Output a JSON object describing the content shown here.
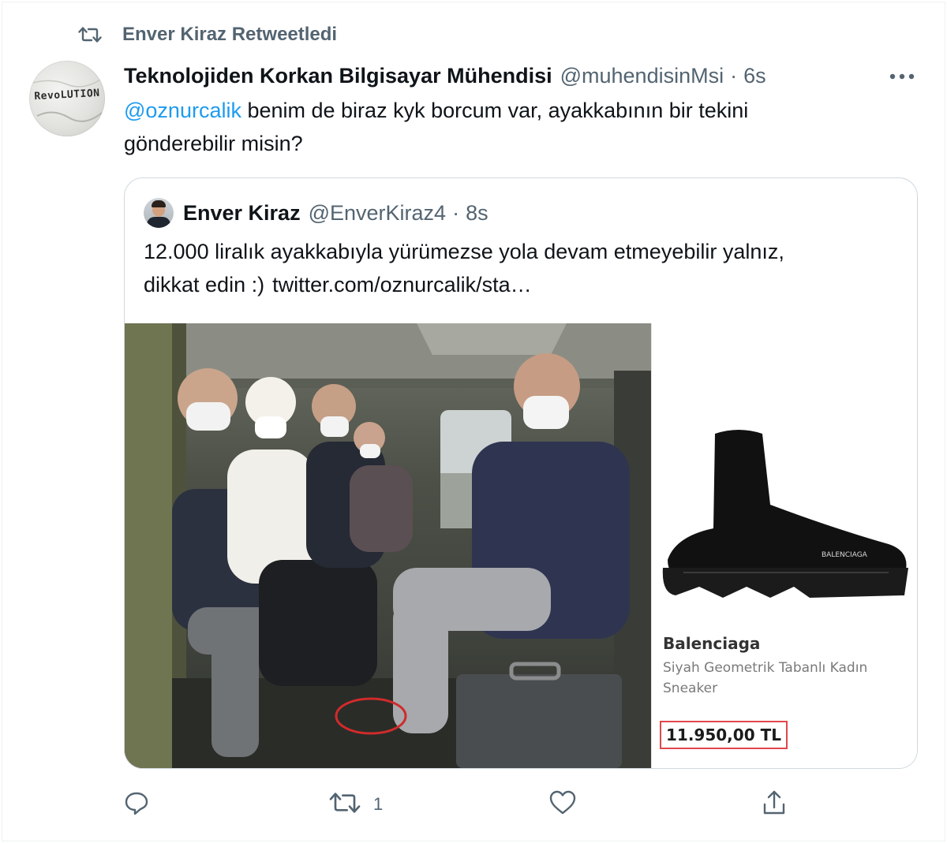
{
  "retweet_header": {
    "icon": "retweet-icon",
    "text": "Enver Kiraz Retweetledi"
  },
  "tweet": {
    "avatar_text": "RevoLUTION",
    "author_name": "Teknolojiden Korkan Bilgisayar Mühendisi",
    "author_handle": "@muhendisinMsi",
    "separator": "·",
    "time": "6s",
    "more_icon": "more-horizontal-icon",
    "mention": "@oznurcalik",
    "text_line1": " benim de biraz kyk borcum var, ayakkabının bir tekini",
    "text_line2": "gönderebilir misin?"
  },
  "quote": {
    "author_name": "Enver Kiraz",
    "author_handle": "@EnverKiraz4",
    "separator": "·",
    "time": "8s",
    "text_line1": "12.000 liralık ayakkabıyla yürümezse yola devam etmeyebilir yalnız,",
    "text_line2": "dikkat edin :)",
    "link": "twitter.com/oznurcalik/sta…",
    "product": {
      "brand": "Balenciaga",
      "description": "Siyah Geometrik Tabanlı Kadın Sneaker",
      "price": "11.950,00 TL",
      "shoe_label": "BALENCIAGA"
    }
  },
  "actions": {
    "reply": {
      "icon": "reply-icon",
      "count": ""
    },
    "retweet": {
      "icon": "retweet-icon",
      "count": "1"
    },
    "like": {
      "icon": "heart-icon",
      "count": ""
    },
    "share": {
      "icon": "share-icon",
      "count": ""
    }
  },
  "colors": {
    "link": "#1d9bf0",
    "secondary_text": "#536471",
    "primary_text": "#0f1419",
    "border": "#cfd9de",
    "price_highlight": "#e0474c"
  }
}
